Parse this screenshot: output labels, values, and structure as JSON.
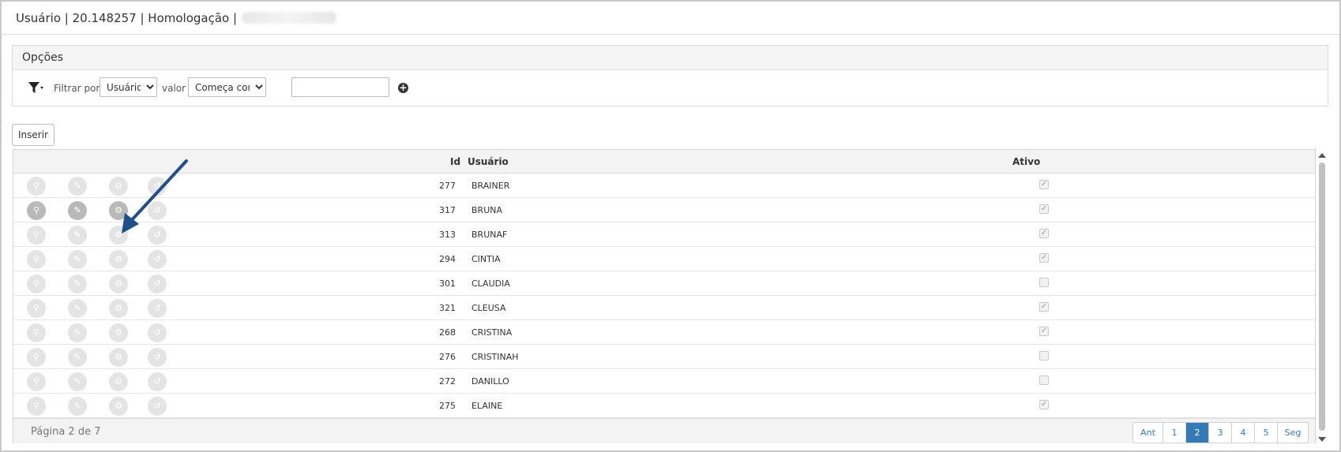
{
  "titlebar": {
    "title": "Usuário | 20.148257 | Homologação |"
  },
  "options": {
    "heading": "Opções",
    "filter_by_label": "Filtrar por",
    "filter_field": "Usuário",
    "value_label": "valor",
    "operator": "Começa com",
    "value_input": ""
  },
  "insert_button": "Inserir",
  "grid": {
    "columns": {
      "id": "Id",
      "user": "Usuário",
      "active": "Ativo"
    },
    "rows": [
      {
        "id": "277",
        "user": "BRAINER",
        "active": true
      },
      {
        "id": "317",
        "user": "BRUNA",
        "active": true
      },
      {
        "id": "313",
        "user": "BRUNAF",
        "active": true
      },
      {
        "id": "294",
        "user": "CINTIA",
        "active": true
      },
      {
        "id": "301",
        "user": "CLAUDIA",
        "active": false
      },
      {
        "id": "321",
        "user": "CLEUSA",
        "active": true
      },
      {
        "id": "268",
        "user": "CRISTINA",
        "active": true
      },
      {
        "id": "276",
        "user": "CRISTINAH",
        "active": false
      },
      {
        "id": "272",
        "user": "DANILLO",
        "active": false
      },
      {
        "id": "275",
        "user": "ELAINE",
        "active": true
      }
    ],
    "page_info": "Página 2 de 7",
    "pager": [
      "Ant",
      "1",
      "2",
      "3",
      "4",
      "5",
      "Seg"
    ],
    "current_page": "2"
  },
  "colors": {
    "accent": "#337ab7",
    "annotation_arrow": "#1f4e8c"
  }
}
